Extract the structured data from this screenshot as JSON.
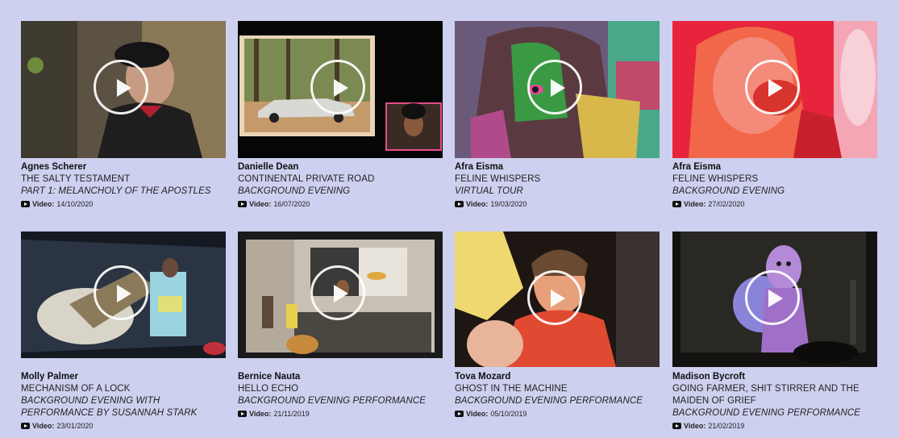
{
  "cards": [
    {
      "artist": "Agnes Scherer",
      "title": "THE SALTY TESTAMENT",
      "subtitle": "PART 1: MELANCHOLY OF THE APOSTLES",
      "video_label": "Video:",
      "date": "14/10/2020"
    },
    {
      "artist": "Danielle Dean",
      "title": "CONTINENTAL PRIVATE ROAD",
      "subtitle": "BACKGROUND EVENING",
      "video_label": "Video:",
      "date": "16/07/2020"
    },
    {
      "artist": "Afra Eisma",
      "title": "FELINE WHISPERS",
      "subtitle": "VIRTUAL TOUR",
      "video_label": "Video:",
      "date": "19/03/2020"
    },
    {
      "artist": "Afra Eisma",
      "title": "FELINE WHISPERS",
      "subtitle": "BACKGROUND EVENING",
      "video_label": "Video:",
      "date": "27/02/2020"
    },
    {
      "artist": "Molly Palmer",
      "title": "MECHANISM OF A LOCK",
      "subtitle": "BACKGROUND EVENING WITH PERFORMANCE BY SUSANNAH STARK",
      "video_label": "Video:",
      "date": "23/01/2020"
    },
    {
      "artist": "Bernice Nauta",
      "title": "HELLO ECHO",
      "subtitle": "BACKGROUND EVENING PERFORMANCE",
      "video_label": "Video:",
      "date": "21/11/2019"
    },
    {
      "artist": "Tova Mozard",
      "title": "GHOST IN THE MACHINE",
      "subtitle": "BACKGROUND EVENING PERFORMANCE",
      "video_label": "Video:",
      "date": "05/10/2019"
    },
    {
      "artist": "Madison Bycroft",
      "title": "GOING FARMER, SHIT STIRRER AND THE MAIDEN OF GRIEF",
      "subtitle": "BACKGROUND EVENING PERFORMANCE",
      "video_label": "Video:",
      "date": "21/02/2019"
    }
  ],
  "icons": {
    "play": "play-circle-icon",
    "youtube": "youtube-icon"
  },
  "colors": {
    "background": "#cdd0ef",
    "text": "#151515"
  }
}
